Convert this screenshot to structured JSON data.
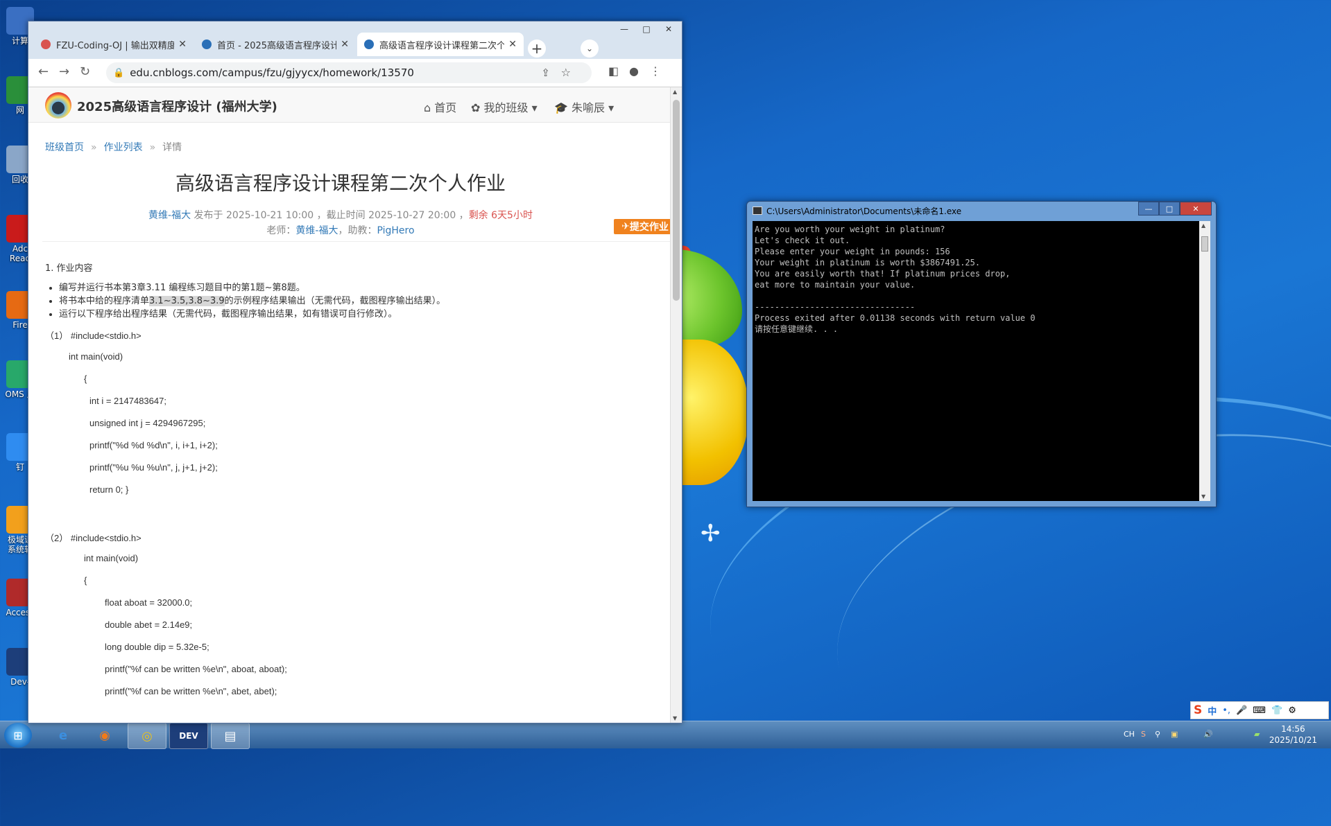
{
  "desktop": {
    "icons": [
      {
        "label": "计算",
        "color": "#3a6fc2"
      },
      {
        "label": "网",
        "color": "#2a8f3a"
      },
      {
        "label": "回收",
        "color": "#8aa6c8"
      },
      {
        "label": "Adc Read",
        "color": "#c91b1b"
      },
      {
        "label": "Fire",
        "color": "#e66a13"
      },
      {
        "label": "OMS 户",
        "color": "#28a86a"
      },
      {
        "label": "钉",
        "color": "#2f8cf0"
      },
      {
        "label": "极域课 系统软",
        "color": "#f2a01c"
      },
      {
        "label": "Access",
        "color": "#b02a2a"
      },
      {
        "label": "Dev-",
        "color": "#1d3e7a"
      }
    ]
  },
  "browser": {
    "tabs": [
      {
        "title": "FZU-Coding-OJ | 输出双精度",
        "icon_color": "#d9534f"
      },
      {
        "title": "首页 - 2025高级语言程序设计",
        "icon_color": "#2a6fb7"
      },
      {
        "title": "高级语言程序设计课程第二次个",
        "icon_color": "#2a6fb7"
      }
    ],
    "url": "edu.cnblogs.com/campus/fzu/gjyycx/homework/13570"
  },
  "site": {
    "title": "2025高级语言程序设计 (福州大学)",
    "nav": [
      "首页",
      "我的班级",
      "朱喻辰"
    ]
  },
  "breadcrumb": [
    "班级首页",
    "作业列表",
    "详情"
  ],
  "homework": {
    "title": "高级语言程序设计课程第二次个人作业",
    "author": "黄维-福大",
    "published": " 发布于 2025-10-21 10:00 ，截止时间 2025-10-27 20:00 ，",
    "remaining": "剩余 6天5小时",
    "teacher_prefix": "老师：",
    "teacher": "黄维-福大",
    "assistant_prefix": "，助教：",
    "assistant": "PigHero",
    "submit_label": "提交作业"
  },
  "content": {
    "section1": "1. 作业内容",
    "bullets": [
      "编写并运行书本第3章3.11 编程练习题目中的第1题~第8题。",
      "将书本中给的程序清单",
      "3.1~3.5,3.8~3.9",
      "的示例程序结果输出（无需代码，截图程序输出结果）。",
      "运行以下程序给出程序结果（无需代码，截图程序输出结果，如有错误可自行修改）。"
    ],
    "code1": [
      "（1） #include<stdio.h>",
      "int main(void)",
      "{",
      "int i = 2147483647;",
      "unsigned int j = 4294967295;",
      "printf(\"%d %d %d\\n\", i, i+1, i+2);",
      "printf(\"%u %u %u\\n\", j, j+1, j+2);",
      "return 0; }"
    ],
    "code2": [
      "（2） #include<stdio.h>",
      "int main(void)",
      "{",
      "float aboat = 32000.0;",
      "double abet = 2.14e9;",
      "long double dip = 5.32e-5;",
      "printf(\"%f can be written %e\\n\", aboat, aboat);",
      "printf(\"%f can be written %e\\n\", abet, abet);"
    ]
  },
  "console": {
    "title": "C:\\Users\\Administrator\\Documents\\未命名1.exe",
    "lines": [
      "Are you worth your weight in platinum?",
      "Let's check it out.",
      "Please enter your weight in pounds: 156",
      "Your weight in platinum is worth $3867491.25.",
      "You are easily worth that! If platinum prices drop,",
      "eat more to maintain your value.",
      "",
      "--------------------------------",
      "Process exited after 0.01138 seconds with return value 0",
      "请按任意键继续. . ."
    ]
  },
  "taskbar": {
    "apps": [
      "e",
      "◉",
      "◎",
      "DEV",
      "▤"
    ],
    "tray_lang": "CH",
    "time": "14:56",
    "date": "2025/10/21",
    "ime": [
      "S",
      "中",
      "•,",
      "🎤",
      "⌨",
      "👕",
      "⚙"
    ]
  }
}
